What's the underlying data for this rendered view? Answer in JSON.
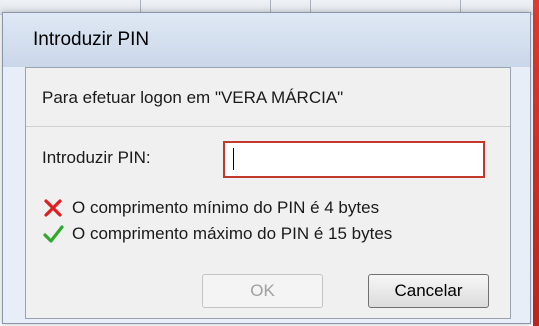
{
  "dialog": {
    "title": "Introduzir PIN",
    "logon_message": "Para efetuar logon em \"VERA MÁRCIA\"",
    "pin_label": "Introduzir PIN:",
    "pin_value": "",
    "rules": [
      {
        "icon": "red-x-icon",
        "status": "failed",
        "text": "O comprimento mínimo do PIN é 4 bytes"
      },
      {
        "icon": "green-check-icon",
        "status": "passed",
        "text": "O comprimento máximo do PIN é 15 bytes"
      }
    ],
    "buttons": {
      "ok": "OK",
      "cancel": "Cancelar"
    }
  },
  "colors": {
    "input_border": "#c0392b",
    "fail_icon": "#e01e1e",
    "pass_icon": "#2ea82e",
    "background_app_accent": "#e23a2f"
  }
}
